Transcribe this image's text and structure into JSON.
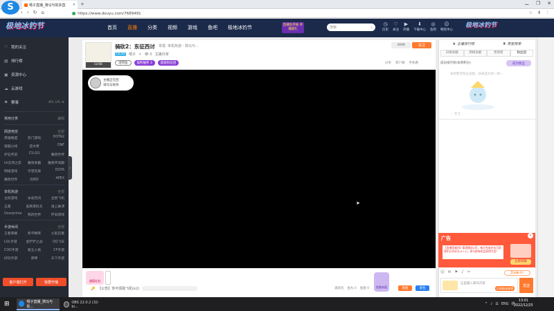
{
  "browser": {
    "tab_title": "嘻子直播_骑马与砍杀直",
    "tab_close": "×",
    "new_tab": "+",
    "window_controls": [
      "⚊",
      "❐",
      "✕"
    ],
    "nav_icons": [
      "‹",
      "›",
      "↻",
      "⌂"
    ],
    "url": "https://www.douyu.com/7689491",
    "right_tools": [
      "☆",
      "⬇",
      "⋮"
    ]
  },
  "douyu": {
    "brand": "极地冰钓节",
    "nav": [
      "首页",
      "直播",
      "分类",
      "视频",
      "游戏",
      "鱼吧",
      "极地冰钓节"
    ],
    "nav_active": 1,
    "promo": "直播生存秘 开播豪礼",
    "search_placeholder": "搜索",
    "search_icon": "⌕",
    "header_icons": [
      {
        "glyph": "◷",
        "label": "历史"
      },
      {
        "glyph": "♡",
        "label": "关注"
      },
      {
        "glyph": "▶",
        "label": "开播"
      },
      {
        "glyph": "⬇",
        "label": "下载中心"
      },
      {
        "glyph": "◎",
        "label": "鱼吧"
      },
      {
        "glyph": "☺",
        "label": "畅玩中心"
      }
    ],
    "right_brand": "极地冰钓节"
  },
  "sidebar": {
    "nav": [
      {
        "icon": "♡",
        "label": "我的关注"
      },
      {
        "icon": "▤",
        "label": "排行榜"
      },
      {
        "icon": "▣",
        "label": "资源中心"
      },
      {
        "icon": "☁",
        "label": "云游戏"
      },
      {
        "icon": "⚑",
        "label": "赛事",
        "extra": "KPL  LPL  ⚙"
      }
    ],
    "sections": [
      {
        "title": "常用分类",
        "more": "编辑",
        "items": []
      },
      {
        "title": "网游竞技",
        "more": "全部",
        "items": [
          "英雄联盟",
          "热门游戏",
          "DOTA2",
          "穿越火线",
          "逆水寒",
          "DNF",
          "炉石传说",
          "CS:GO",
          "魔兽世界",
          "lol云顶之弈",
          "魔兽争霸",
          "魔兽怀旧服",
          "网络游戏",
          "守望先锋",
          "DOTA",
          "魔兽世界",
          "剑网3",
          "APEX"
        ]
      },
      {
        "title": "单机热游",
        "more": "全部",
        "items": [
          "主机游戏",
          "永劫无间",
          "全民飞机",
          "五美",
          "逃离塔科夫",
          "骑上鼻涕",
          "Overprime",
          "我的世界",
          "怀旧游戏"
        ]
      },
      {
        "title": "手游休闲",
        "more": "全部",
        "items": [
          "王者荣耀",
          "和平精英",
          "火影忍者",
          "LOL手游",
          "金铲铲之战",
          "QQ飞车",
          "COD手游",
          "第五人格",
          "CF手游",
          "好玩手游",
          "原神",
          "天下手游"
        ]
      }
    ],
    "buttons": [
      "客户端打开",
      "我要开播"
    ],
    "collapse": "‹"
  },
  "room": {
    "avatar_level": "LV.66",
    "title": "骑砍2：东征西讨",
    "report": "举报",
    "category": "单机热游 - 骑马与...",
    "owner_badge": "Lv.33",
    "owner": "嘻子",
    "heat": "👁 0",
    "heat_icon": "☼",
    "rank": "主播日常",
    "tags": [
      "话唠鱼",
      "福利抽奖 3",
      "超级粉丝团"
    ],
    "follow_count": "3698",
    "follow_label": "关注",
    "actions": [
      "分享",
      "客户端",
      "手机看"
    ],
    "video_info": [
      "主播正在回",
      "骑马与砍杀"
    ],
    "video_info_close": "×"
  },
  "bottombar": {
    "gift1": "超值礼包",
    "chat_label": "【公告】你可领取飞机(x2)",
    "right_items": [
      "道具包",
      "鱼丸 0",
      "鱼翅 0"
    ],
    "gift_mid": "鱼翅充值",
    "send": "充值",
    "send2": "背包"
  },
  "right_panel": {
    "top": [
      {
        "icon": "♛",
        "label": "主播排行榜"
      },
      {
        "icon": "♜",
        "label": "周星榜单"
      }
    ],
    "tabs": [
      "日榜贡献",
      "周榜贡献",
      "贵宾席",
      "粉丝团"
    ],
    "tab_active": 3,
    "week_text": "成员排行榜(本周积分)",
    "week_btn": "成为粉丝",
    "empty_text": "本周暂无粉丝贡献，快来成为第一吧~",
    "empty_sub": "- - 暂无 - -",
    "ad_head": "广告",
    "ad_text": "【直播家福利】看直播送Q币，每天完成任务可获得积分兑好礼(4+1)，参与即有机会获得大奖！",
    "ad_btn": "立即领取",
    "ad_close": "×",
    "tool_icons": [
      "☺",
      "✉",
      "⚑",
      "♪",
      "✂"
    ],
    "count_label": "荧光棒 0个",
    "input_placeholder": "这里输入聊天内容",
    "input_btn": "点亮粉丝勋章",
    "send": "发送"
  },
  "taskbar": {
    "start": "⊞",
    "task1": "嘻子直播_骑马与砍...",
    "task2": "OBS 22.0.2 (32-bi...",
    "tray": [
      "^",
      "♪",
      "☰",
      "ENG",
      "拼"
    ],
    "time": "13:01",
    "date": "2022/12/25"
  },
  "colors": {
    "accent": "#ff7a2e",
    "header_bg": "#1b2a4a",
    "sidebar_bg": "#262a33",
    "purple": "#8b3fd6"
  }
}
